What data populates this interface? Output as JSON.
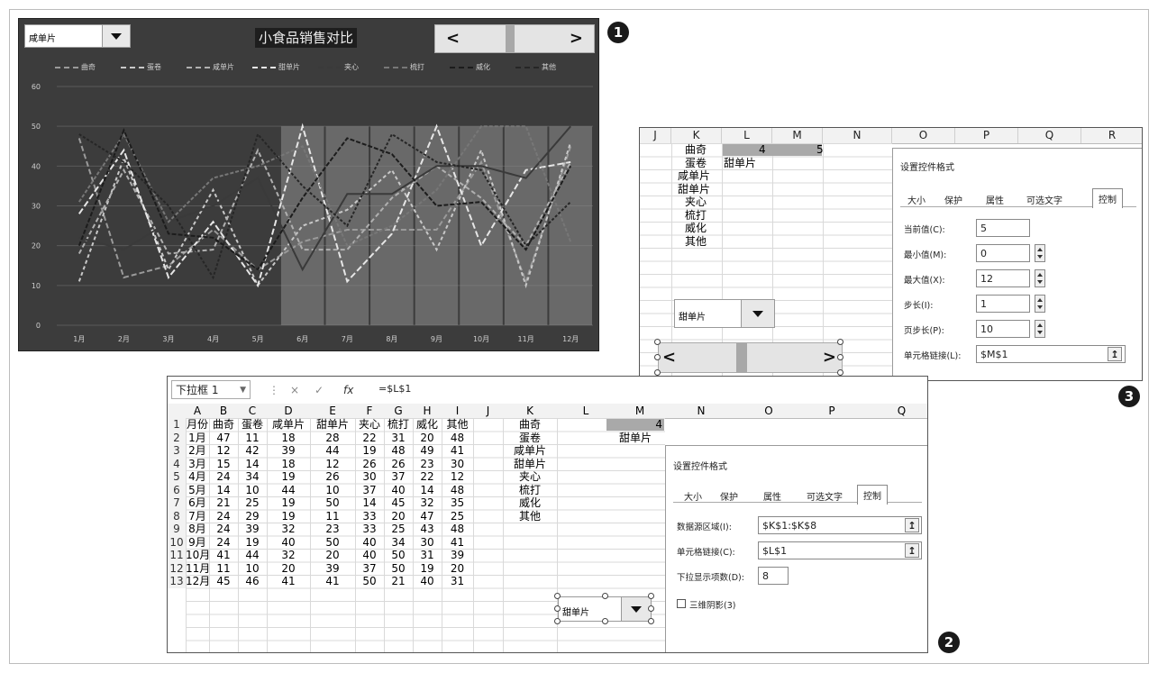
{
  "badges": {
    "one": "1",
    "two": "2",
    "three": "3"
  },
  "chart_panel": {
    "dropdown_value": "咸单片",
    "title": "小食品销售对比",
    "scroll_left": "<",
    "scroll_right": ">",
    "scroll_value": 5,
    "scroll_max": 12
  },
  "chart_data": {
    "type": "line",
    "title": "小食品销售对比",
    "categories": [
      "1月",
      "2月",
      "3月",
      "4月",
      "5月",
      "6月",
      "7月",
      "8月",
      "9月",
      "10月",
      "11月",
      "12月"
    ],
    "y_ticks": [
      "0",
      "10",
      "20",
      "30",
      "40",
      "50",
      "60"
    ],
    "ylim": [
      0,
      60
    ],
    "grid": true,
    "legend_position": "top",
    "highlight_range": [
      "6月",
      "12月"
    ],
    "highlight_value": 50,
    "series": [
      {
        "name": "曲奇",
        "values": [
          47,
          12,
          15,
          24,
          14,
          21,
          24,
          24,
          24,
          41,
          11,
          45
        ],
        "color": "#9a9a9a"
      },
      {
        "name": "蛋卷",
        "values": [
          11,
          42,
          14,
          34,
          10,
          25,
          29,
          39,
          19,
          44,
          10,
          46
        ],
        "color": "#c8c8c8"
      },
      {
        "name": "咸单片",
        "values": [
          18,
          39,
          18,
          19,
          44,
          19,
          19,
          32,
          40,
          32,
          20,
          41
        ],
        "color": "#b0b0b0"
      },
      {
        "name": "甜单片",
        "values": [
          28,
          44,
          12,
          26,
          10,
          50,
          11,
          23,
          50,
          20,
          39,
          41
        ],
        "color": "#e6e6e6"
      },
      {
        "name": "夹心",
        "values": [
          22,
          19,
          26,
          30,
          37,
          14,
          33,
          33,
          40,
          40,
          37,
          50
        ],
        "color": "#3a3a3a"
      },
      {
        "name": "梳打",
        "values": [
          31,
          48,
          26,
          37,
          40,
          45,
          20,
          25,
          34,
          50,
          50,
          21
        ],
        "color": "#777777"
      },
      {
        "name": "威化",
        "values": [
          20,
          49,
          23,
          22,
          14,
          32,
          47,
          43,
          30,
          31,
          19,
          40
        ],
        "color": "#1c1c1c"
      },
      {
        "name": "其他",
        "values": [
          48,
          41,
          30,
          12,
          48,
          35,
          25,
          48,
          41,
          39,
          20,
          31
        ],
        "color": "#262626"
      }
    ]
  },
  "panel3": {
    "columns": [
      "J",
      "K",
      "L",
      "M",
      "N",
      "O",
      "P",
      "Q",
      "R"
    ],
    "list": [
      "曲奇",
      "蛋卷",
      "咸单片",
      "甜单片",
      "夹心",
      "梳打",
      "威化",
      "其他"
    ],
    "L1": "4",
    "M1": "5",
    "L2": "甜单片",
    "combo_value": "甜单片",
    "scroll_left": "<",
    "scroll_right": ">",
    "dialog": {
      "title": "设置控件格式",
      "tabs": [
        "大小",
        "保护",
        "属性",
        "可选文字",
        "控制"
      ],
      "current_label": "当前值(C):",
      "current_value": "5",
      "min_label": "最小值(M):",
      "min_value": "0",
      "max_label": "最大值(X):",
      "max_value": "12",
      "step_label": "步长(I):",
      "step_value": "1",
      "page_label": "页步长(P):",
      "page_value": "10",
      "link_label": "单元格链接(L):",
      "link_value": "$M$1",
      "ref_icon": "↥"
    }
  },
  "panel2": {
    "name_box": "下拉框 1",
    "formula": "=$L$1",
    "fx": "fx",
    "cancel": "×",
    "enter": "✓",
    "column_letters": [
      "A",
      "B",
      "C",
      "D",
      "E",
      "F",
      "G",
      "H",
      "I",
      "J",
      "K",
      "L",
      "M",
      "N",
      "O",
      "P",
      "Q"
    ],
    "headers": [
      "月份",
      "曲奇",
      "蛋卷",
      "咸单片",
      "甜单片",
      "夹心",
      "梳打",
      "威化",
      "其他"
    ],
    "rows": [
      [
        "1月",
        "47",
        "11",
        "18",
        "28",
        "22",
        "31",
        "20",
        "48"
      ],
      [
        "2月",
        "12",
        "42",
        "39",
        "44",
        "19",
        "48",
        "49",
        "41"
      ],
      [
        "3月",
        "15",
        "14",
        "18",
        "12",
        "26",
        "26",
        "23",
        "30"
      ],
      [
        "4月",
        "24",
        "34",
        "19",
        "26",
        "30",
        "37",
        "22",
        "12"
      ],
      [
        "5月",
        "14",
        "10",
        "44",
        "10",
        "37",
        "40",
        "14",
        "48"
      ],
      [
        "6月",
        "21",
        "25",
        "19",
        "50",
        "14",
        "45",
        "32",
        "35"
      ],
      [
        "7月",
        "24",
        "29",
        "19",
        "11",
        "33",
        "20",
        "47",
        "25"
      ],
      [
        "8月",
        "24",
        "39",
        "32",
        "23",
        "33",
        "25",
        "43",
        "48"
      ],
      [
        "9月",
        "24",
        "19",
        "40",
        "50",
        "40",
        "34",
        "30",
        "41"
      ],
      [
        "10月",
        "41",
        "44",
        "32",
        "20",
        "40",
        "50",
        "31",
        "39"
      ],
      [
        "11月",
        "11",
        "10",
        "20",
        "39",
        "37",
        "50",
        "19",
        "20"
      ],
      [
        "12月",
        "45",
        "46",
        "41",
        "41",
        "50",
        "21",
        "40",
        "31"
      ]
    ],
    "row_numbers": [
      "1",
      "2",
      "3",
      "4",
      "5",
      "6",
      "7",
      "8",
      "9",
      "10",
      "11",
      "12",
      "13"
    ],
    "list": [
      "曲奇",
      "蛋卷",
      "咸单片",
      "甜单片",
      "夹心",
      "梳打",
      "威化",
      "其他"
    ],
    "L1": "4",
    "L2": "甜单片",
    "combo_value": "甜单片",
    "dialog": {
      "title": "设置控件格式",
      "tabs": [
        "大小",
        "保护",
        "属性",
        "可选文字",
        "控制"
      ],
      "source_label": "数据源区域(I):",
      "source_value": "$K$1:$K$8",
      "link_label": "单元格链接(C):",
      "link_value": "$L$1",
      "lines_label": "下拉显示项数(D):",
      "lines_value": "8",
      "shading_label": "三维阴影(3)",
      "ref_icon": "↥"
    }
  }
}
